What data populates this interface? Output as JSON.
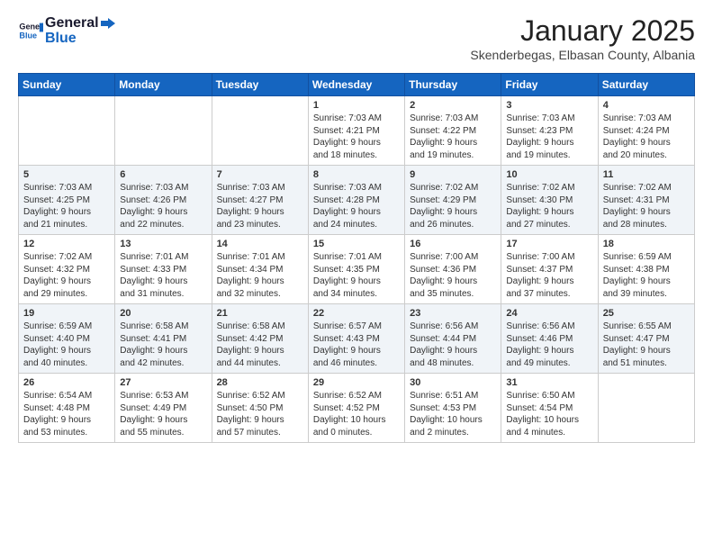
{
  "header": {
    "logo_general": "General",
    "logo_blue": "Blue",
    "month": "January 2025",
    "location": "Skenderbegas, Elbasan County, Albania"
  },
  "days_of_week": [
    "Sunday",
    "Monday",
    "Tuesday",
    "Wednesday",
    "Thursday",
    "Friday",
    "Saturday"
  ],
  "weeks": [
    [
      {
        "day": "",
        "info": ""
      },
      {
        "day": "",
        "info": ""
      },
      {
        "day": "",
        "info": ""
      },
      {
        "day": "1",
        "info": "Sunrise: 7:03 AM\nSunset: 4:21 PM\nDaylight: 9 hours\nand 18 minutes."
      },
      {
        "day": "2",
        "info": "Sunrise: 7:03 AM\nSunset: 4:22 PM\nDaylight: 9 hours\nand 19 minutes."
      },
      {
        "day": "3",
        "info": "Sunrise: 7:03 AM\nSunset: 4:23 PM\nDaylight: 9 hours\nand 19 minutes."
      },
      {
        "day": "4",
        "info": "Sunrise: 7:03 AM\nSunset: 4:24 PM\nDaylight: 9 hours\nand 20 minutes."
      }
    ],
    [
      {
        "day": "5",
        "info": "Sunrise: 7:03 AM\nSunset: 4:25 PM\nDaylight: 9 hours\nand 21 minutes."
      },
      {
        "day": "6",
        "info": "Sunrise: 7:03 AM\nSunset: 4:26 PM\nDaylight: 9 hours\nand 22 minutes."
      },
      {
        "day": "7",
        "info": "Sunrise: 7:03 AM\nSunset: 4:27 PM\nDaylight: 9 hours\nand 23 minutes."
      },
      {
        "day": "8",
        "info": "Sunrise: 7:03 AM\nSunset: 4:28 PM\nDaylight: 9 hours\nand 24 minutes."
      },
      {
        "day": "9",
        "info": "Sunrise: 7:02 AM\nSunset: 4:29 PM\nDaylight: 9 hours\nand 26 minutes."
      },
      {
        "day": "10",
        "info": "Sunrise: 7:02 AM\nSunset: 4:30 PM\nDaylight: 9 hours\nand 27 minutes."
      },
      {
        "day": "11",
        "info": "Sunrise: 7:02 AM\nSunset: 4:31 PM\nDaylight: 9 hours\nand 28 minutes."
      }
    ],
    [
      {
        "day": "12",
        "info": "Sunrise: 7:02 AM\nSunset: 4:32 PM\nDaylight: 9 hours\nand 29 minutes."
      },
      {
        "day": "13",
        "info": "Sunrise: 7:01 AM\nSunset: 4:33 PM\nDaylight: 9 hours\nand 31 minutes."
      },
      {
        "day": "14",
        "info": "Sunrise: 7:01 AM\nSunset: 4:34 PM\nDaylight: 9 hours\nand 32 minutes."
      },
      {
        "day": "15",
        "info": "Sunrise: 7:01 AM\nSunset: 4:35 PM\nDaylight: 9 hours\nand 34 minutes."
      },
      {
        "day": "16",
        "info": "Sunrise: 7:00 AM\nSunset: 4:36 PM\nDaylight: 9 hours\nand 35 minutes."
      },
      {
        "day": "17",
        "info": "Sunrise: 7:00 AM\nSunset: 4:37 PM\nDaylight: 9 hours\nand 37 minutes."
      },
      {
        "day": "18",
        "info": "Sunrise: 6:59 AM\nSunset: 4:38 PM\nDaylight: 9 hours\nand 39 minutes."
      }
    ],
    [
      {
        "day": "19",
        "info": "Sunrise: 6:59 AM\nSunset: 4:40 PM\nDaylight: 9 hours\nand 40 minutes."
      },
      {
        "day": "20",
        "info": "Sunrise: 6:58 AM\nSunset: 4:41 PM\nDaylight: 9 hours\nand 42 minutes."
      },
      {
        "day": "21",
        "info": "Sunrise: 6:58 AM\nSunset: 4:42 PM\nDaylight: 9 hours\nand 44 minutes."
      },
      {
        "day": "22",
        "info": "Sunrise: 6:57 AM\nSunset: 4:43 PM\nDaylight: 9 hours\nand 46 minutes."
      },
      {
        "day": "23",
        "info": "Sunrise: 6:56 AM\nSunset: 4:44 PM\nDaylight: 9 hours\nand 48 minutes."
      },
      {
        "day": "24",
        "info": "Sunrise: 6:56 AM\nSunset: 4:46 PM\nDaylight: 9 hours\nand 49 minutes."
      },
      {
        "day": "25",
        "info": "Sunrise: 6:55 AM\nSunset: 4:47 PM\nDaylight: 9 hours\nand 51 minutes."
      }
    ],
    [
      {
        "day": "26",
        "info": "Sunrise: 6:54 AM\nSunset: 4:48 PM\nDaylight: 9 hours\nand 53 minutes."
      },
      {
        "day": "27",
        "info": "Sunrise: 6:53 AM\nSunset: 4:49 PM\nDaylight: 9 hours\nand 55 minutes."
      },
      {
        "day": "28",
        "info": "Sunrise: 6:52 AM\nSunset: 4:50 PM\nDaylight: 9 hours\nand 57 minutes."
      },
      {
        "day": "29",
        "info": "Sunrise: 6:52 AM\nSunset: 4:52 PM\nDaylight: 10 hours\nand 0 minutes."
      },
      {
        "day": "30",
        "info": "Sunrise: 6:51 AM\nSunset: 4:53 PM\nDaylight: 10 hours\nand 2 minutes."
      },
      {
        "day": "31",
        "info": "Sunrise: 6:50 AM\nSunset: 4:54 PM\nDaylight: 10 hours\nand 4 minutes."
      },
      {
        "day": "",
        "info": ""
      }
    ]
  ]
}
